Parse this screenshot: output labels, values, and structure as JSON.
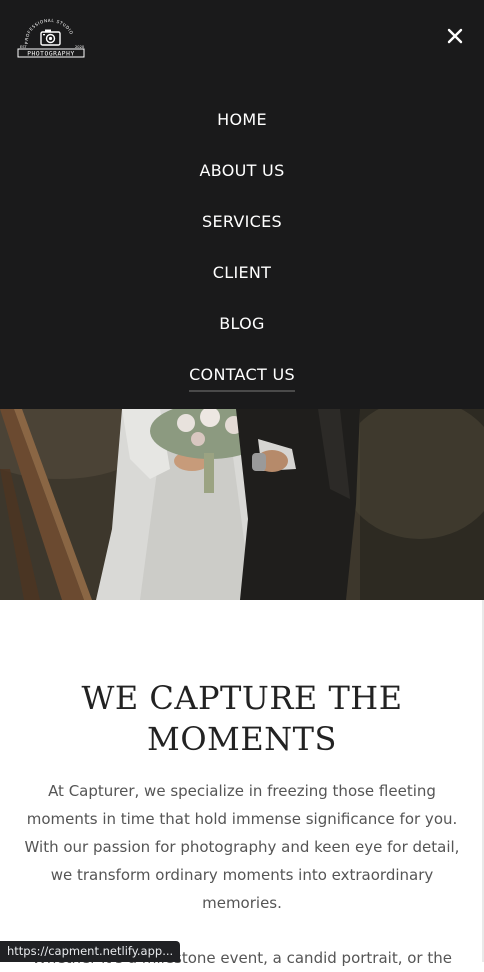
{
  "logo": {
    "arc_text": "PROFESSIONAL STUDIO",
    "name": "PHOTOGRAPHY",
    "est_left": "EST",
    "est_right": "2020"
  },
  "nav": {
    "close_icon": "close-icon",
    "items": [
      {
        "label": "HOME"
      },
      {
        "label": "ABOUT US"
      },
      {
        "label": "SERVICES"
      },
      {
        "label": "CLIENT"
      },
      {
        "label": "BLOG"
      },
      {
        "label": "CONTACT US",
        "active": true
      }
    ]
  },
  "hero": {
    "image": "wedding-couple-photo"
  },
  "main": {
    "headline_line1": "WE CAPTURE THE",
    "headline_line2": "MOMENTS",
    "paragraph": "At Capturer, we specialize in freezing those fleeting moments in time that hold immense significance for you. With our passion for photography and keen eye for detail, we transform ordinary moments into extraordinary memories.",
    "paragraph2_partial": "Whether it's a milestone event, a candid portrait, or the"
  },
  "status_bar": {
    "url": "https://capment.netlify.app..."
  }
}
